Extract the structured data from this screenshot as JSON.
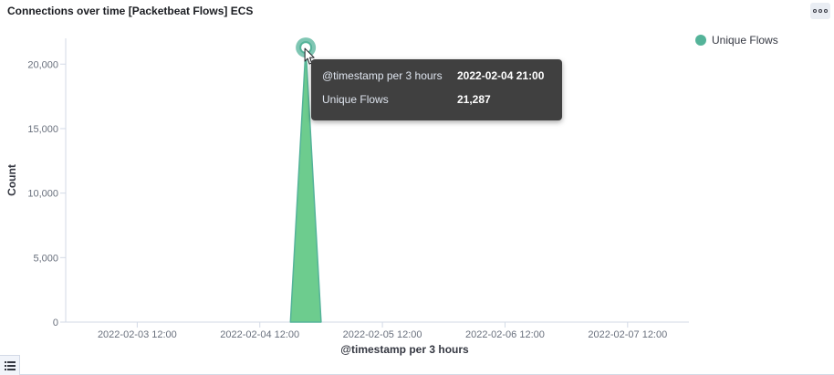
{
  "panel": {
    "title": "Connections over time [Packetbeat Flows] ECS",
    "options_icon": "ellipsis-icon",
    "legend_toggle_icon": "list-icon"
  },
  "colors": {
    "series": "#54b399",
    "area_fill": "#6dcc8e",
    "tooltip_bg": "#404040"
  },
  "tooltip": {
    "rows": [
      {
        "key": "@timestamp per 3 hours",
        "value": "2022-02-04 21:00"
      },
      {
        "key": "Unique Flows",
        "value": "21,287"
      }
    ]
  },
  "chart_data": {
    "type": "area",
    "title": "Connections over time [Packetbeat Flows] ECS",
    "xlabel": "@timestamp per 3 hours",
    "ylabel": "Count",
    "x_ticks": [
      "2022-02-03 12:00",
      "2022-02-04 12:00",
      "2022-02-05 12:00",
      "2022-02-06 12:00",
      "2022-02-07 12:00"
    ],
    "y_ticks": [
      "0",
      "5,000",
      "10,000",
      "15,000",
      "20,000"
    ],
    "ylim": [
      0,
      22000
    ],
    "xlim": [
      "2022-02-02 22:00",
      "2022-02-08 00:00"
    ],
    "series": [
      {
        "name": "Unique Flows",
        "points": [
          {
            "x": "2022-02-04 18:00",
            "y": 0
          },
          {
            "x": "2022-02-04 21:00",
            "y": 21287
          },
          {
            "x": "2022-02-05 00:00",
            "y": 0
          }
        ]
      }
    ],
    "highlighted_point": {
      "x": "2022-02-04 21:00",
      "y": 21287
    },
    "legend": {
      "position": "top-right",
      "entries": [
        "Unique Flows"
      ]
    },
    "grid": false
  }
}
